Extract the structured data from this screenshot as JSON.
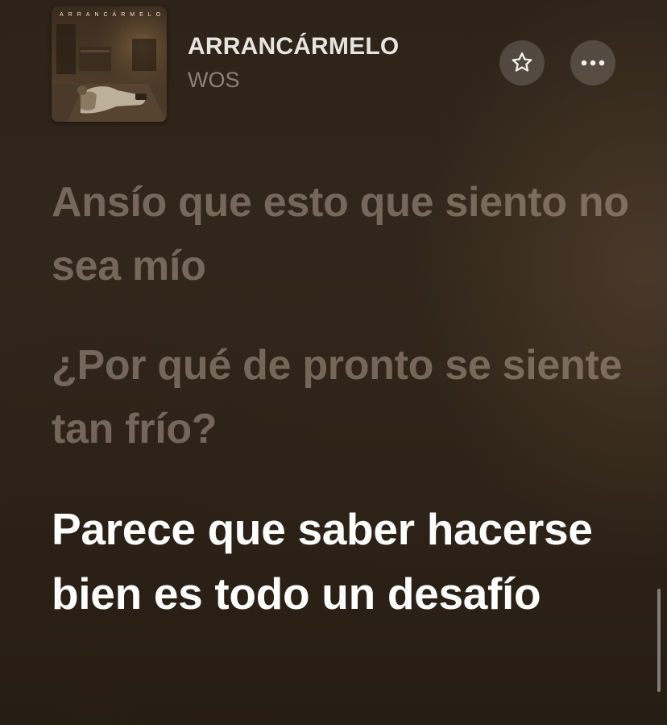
{
  "now_playing": {
    "artwork": {
      "title_text": "ARRANCÁRMELO",
      "description_icon": "album-artwork"
    },
    "title": "ARRANCÁRMELO",
    "artist": "WOS"
  },
  "controls": {
    "favorite_icon": "star-icon",
    "more_icon": "ellipsis-icon"
  },
  "lyrics": {
    "past_lines": [
      "Ansío que esto que siento no sea mío",
      "¿Por qué de pronto se siente tan frío?"
    ],
    "current_line": "Parece que saber hacerse bien es todo un desafío"
  },
  "colors": {
    "background": "#2f241a",
    "active_lyric": "#ffffff",
    "inactive_lyric": "#7c6e61",
    "title": "#e8e4df",
    "artist": "#8b8177"
  }
}
